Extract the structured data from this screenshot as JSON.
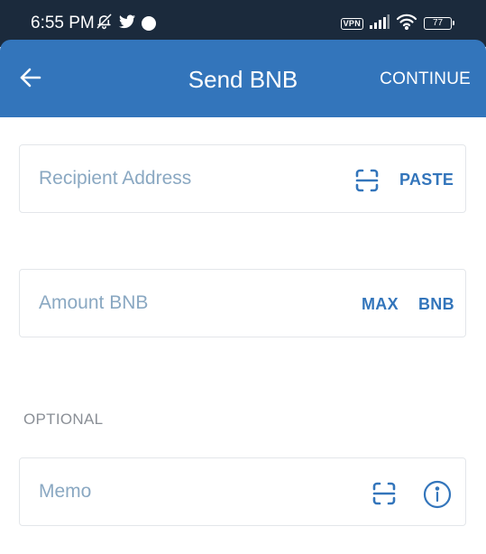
{
  "status_bar": {
    "time": "6:55 PM",
    "vpn_label": "VPN",
    "battery_level": "77",
    "icons": [
      "bell-off-icon",
      "twitter-icon",
      "circle-icon",
      "vpn-icon",
      "signal-icon",
      "wifi-icon",
      "battery-icon"
    ]
  },
  "header": {
    "back_icon": "arrow-left-icon",
    "title": "Send BNB",
    "continue_label": "CONTINUE",
    "background_color": "#3375bb"
  },
  "form": {
    "recipient": {
      "placeholder": "Recipient Address",
      "value": "",
      "scan_icon": "qr-scan-icon",
      "paste_label": "PASTE"
    },
    "amount": {
      "placeholder": "Amount BNB",
      "value": "",
      "max_label": "MAX",
      "currency_label": "BNB"
    },
    "optional_label": "OPTIONAL",
    "memo": {
      "placeholder": "Memo",
      "value": "",
      "scan_icon": "qr-scan-icon",
      "info_icon": "info-icon"
    }
  },
  "colors": {
    "status_bar": "#1b2a3c",
    "accent": "#3375bb",
    "placeholder": "#8aa8c2",
    "border": "#e3e6ea",
    "muted_label": "#8a8f96"
  }
}
